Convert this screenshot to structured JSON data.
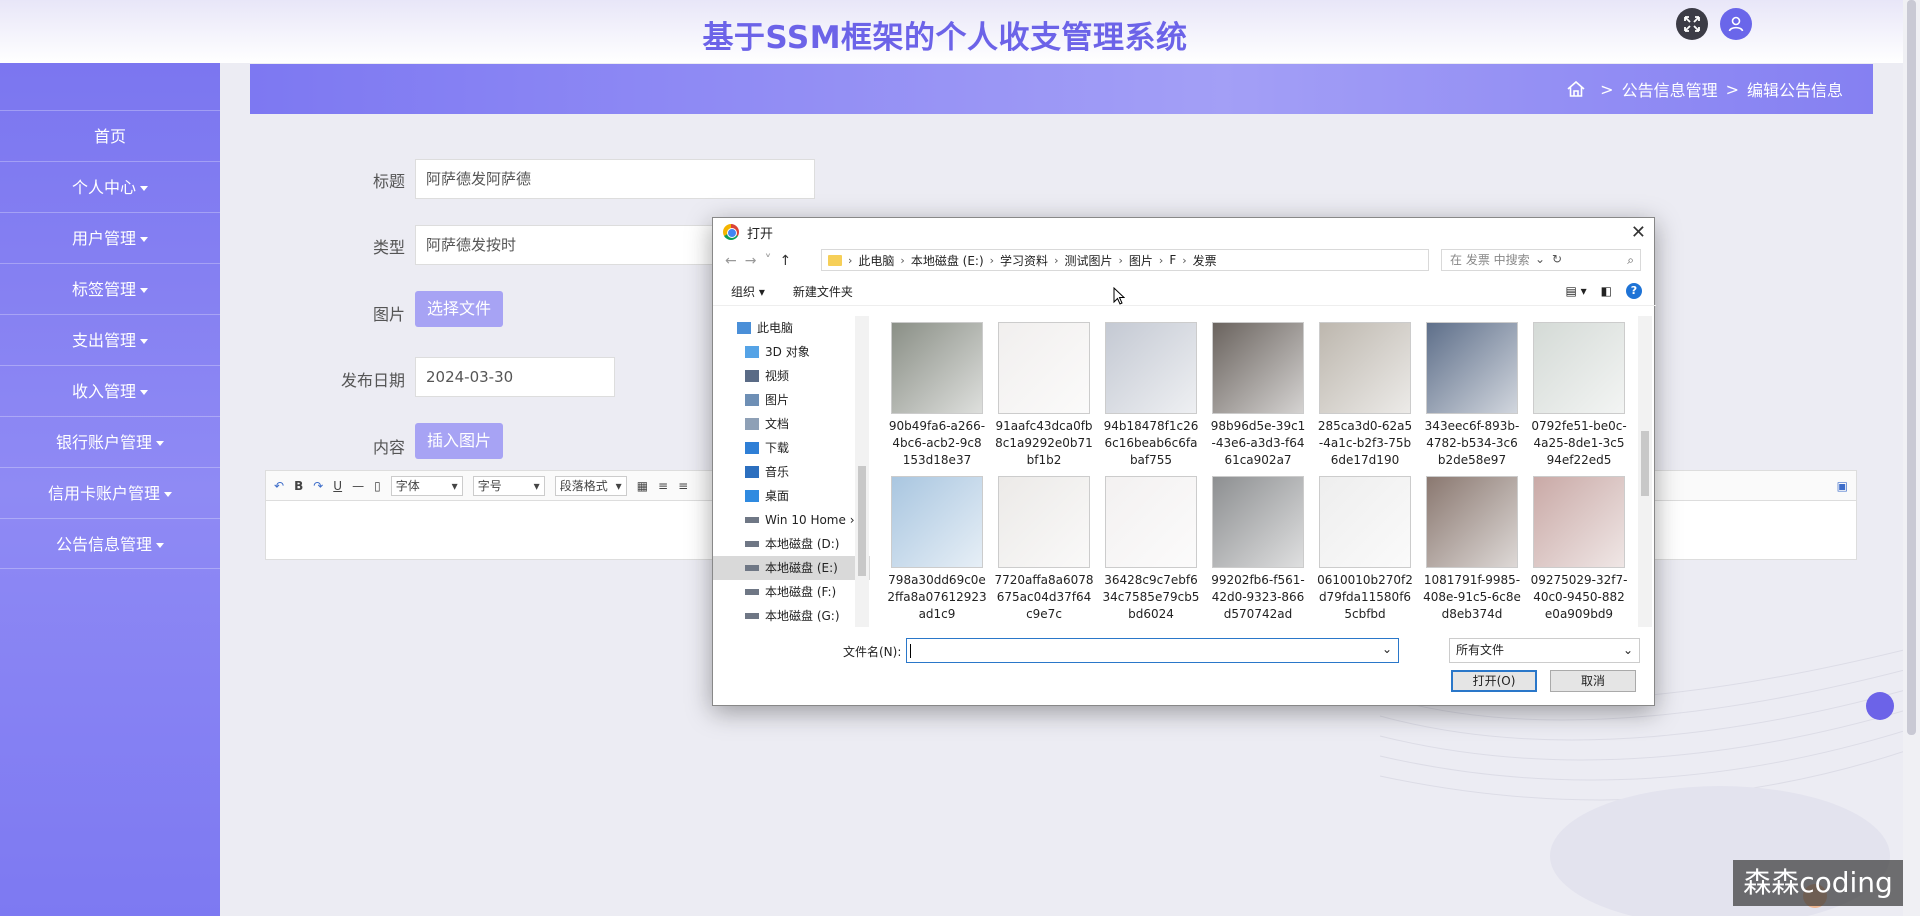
{
  "app": {
    "title": "基于SSM框架的个人收支管理系统"
  },
  "sidebar": {
    "items": [
      {
        "label": "首页",
        "has_caret": false
      },
      {
        "label": "个人中心",
        "has_caret": true
      },
      {
        "label": "用户管理",
        "has_caret": true
      },
      {
        "label": "标签管理",
        "has_caret": true
      },
      {
        "label": "支出管理",
        "has_caret": true
      },
      {
        "label": "收入管理",
        "has_caret": true
      },
      {
        "label": "银行账户管理",
        "has_caret": true
      },
      {
        "label": "信用卡账户管理",
        "has_caret": true
      },
      {
        "label": "公告信息管理",
        "has_caret": true
      }
    ]
  },
  "breadcrumb": {
    "sep": ">",
    "items": [
      "公告信息管理",
      "编辑公告信息"
    ]
  },
  "form": {
    "title_label": "标题",
    "title_value": "阿萨德发阿萨德",
    "type_label": "类型",
    "type_value": "阿萨德发按时",
    "image_label": "图片",
    "choose_file": "选择文件",
    "date_label": "发布日期",
    "date_value": "2024-03-30",
    "content_label": "内容",
    "insert_image": "插入图片"
  },
  "editor": {
    "font": "字体",
    "size": "字号",
    "paragraph": "段落格式"
  },
  "dialog": {
    "title": "打开",
    "path": [
      "此电脑",
      "本地磁盘 (E:)",
      "学习资料",
      "测试图片",
      "图片",
      "F",
      "发票"
    ],
    "search_placeholder": "在 发票 中搜索",
    "organize": "组织",
    "new_folder": "新建文件夹",
    "nav": [
      {
        "label": "此电脑",
        "icon": "computer-icon",
        "selected": false
      },
      {
        "label": "3D 对象",
        "icon": "cube-icon",
        "selected": false
      },
      {
        "label": "视频",
        "icon": "video-icon",
        "selected": false
      },
      {
        "label": "图片",
        "icon": "picture-icon",
        "selected": false
      },
      {
        "label": "文档",
        "icon": "document-icon",
        "selected": false
      },
      {
        "label": "下载",
        "icon": "download-icon",
        "selected": false
      },
      {
        "label": "音乐",
        "icon": "music-icon",
        "selected": false
      },
      {
        "label": "桌面",
        "icon": "desktop-icon",
        "selected": false
      },
      {
        "label": "Win 10 Home ›",
        "icon": "drive-icon",
        "selected": false
      },
      {
        "label": "本地磁盘 (D:)",
        "icon": "drive-icon",
        "selected": false
      },
      {
        "label": "本地磁盘 (E:)",
        "icon": "drive-icon",
        "selected": true
      },
      {
        "label": "本地磁盘 (F:)",
        "icon": "drive-icon",
        "selected": false
      },
      {
        "label": "本地磁盘 (G:)",
        "icon": "drive-icon",
        "selected": false
      }
    ],
    "files": [
      {
        "l1": "90b49fa6-a266-",
        "l2": "4bc6-acb2-9c8",
        "l3": "153d18e37",
        "tone": "#8a8f86"
      },
      {
        "l1": "91aafc43dca0fb",
        "l2": "8c1a9292e0b71",
        "l3": "bf1b2",
        "tone": "#f1efee"
      },
      {
        "l1": "94b18478f1c26",
        "l2": "6c16beab6c6fa",
        "l3": "baf755",
        "tone": "#c4c9d3"
      },
      {
        "l1": "98b96d5e-39c1",
        "l2": "-43e6-a3d3-f64",
        "l3": "61ca902a7",
        "tone": "#6a635e"
      },
      {
        "l1": "285ca3d0-62a5",
        "l2": "-4a1c-b2f3-75b",
        "l3": "6de17d190",
        "tone": "#bdb7ae"
      },
      {
        "l1": "343eec6f-893b-",
        "l2": "4782-b534-3c6",
        "l3": "b2de58e97",
        "tone": "#5e6f8a"
      },
      {
        "l1": "0792fe51-be0c-",
        "l2": "4a25-8de1-3c5",
        "l3": "94ef22ed5",
        "tone": "#d4dad6"
      },
      {
        "l1": "798a30dd69c0e",
        "l2": "2ffa8a07612923",
        "l3": "ad1c9",
        "tone": "#a9c6e0"
      },
      {
        "l1": "7720affa8a6078",
        "l2": "675ac04d37f64",
        "l3": "c9e7c",
        "tone": "#eceae8"
      },
      {
        "l1": "36428c9c7ebf6",
        "l2": "34c7585e79cb5",
        "l3": "bd6024",
        "tone": "#f3f1f1"
      },
      {
        "l1": "99202fb6-f561-",
        "l2": "42d0-9323-866",
        "l3": "d570742ad",
        "tone": "#8d8f91"
      },
      {
        "l1": "0610010b270f2",
        "l2": "d79fda11580f6",
        "l3": "5cbfbd",
        "tone": "#eeeeee"
      },
      {
        "l1": "1081791f-9985-",
        "l2": "408e-91c5-6c8e",
        "l3": "d8eb374d",
        "tone": "#8a7870"
      },
      {
        "l1": "09275029-32f7-",
        "l2": "40c0-9450-882",
        "l3": "e0a909bd9",
        "tone": "#c9a9a6"
      }
    ],
    "filename_label": "文件名(N):",
    "filename_value": "",
    "filter": "所有文件",
    "open_btn": "打开(O)",
    "cancel_btn": "取消"
  },
  "watermark": "森森coding",
  "colors": {
    "accent": "#6c63e8",
    "sidebar": "#7b76f0",
    "button": "#a7a3f4"
  }
}
